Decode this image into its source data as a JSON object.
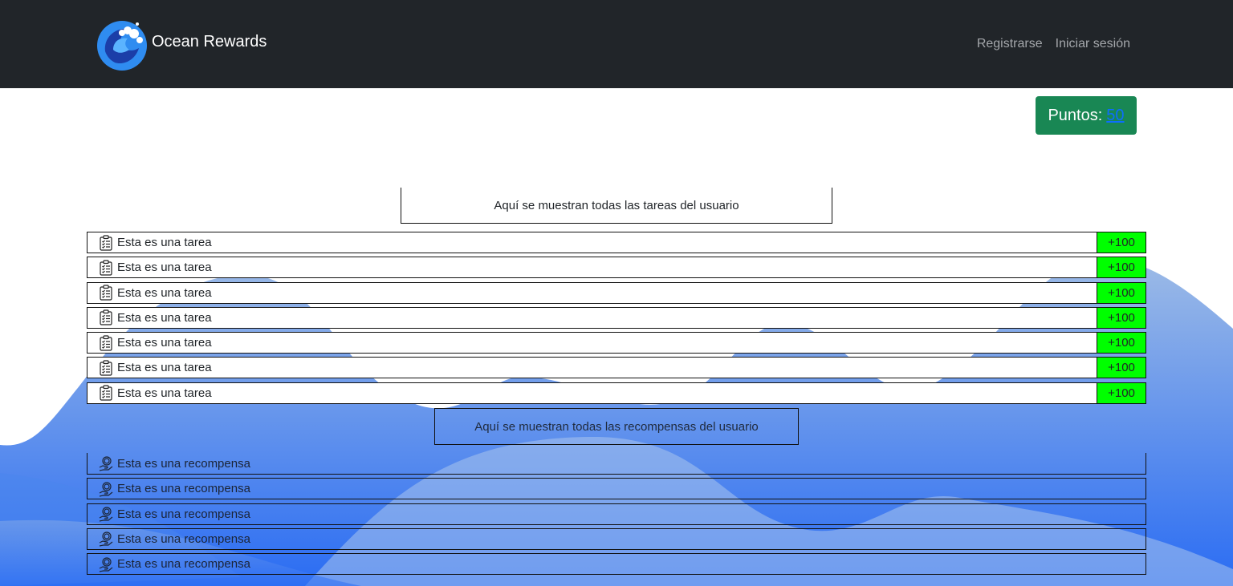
{
  "app": {
    "brand": "Ocean Rewards"
  },
  "nav": {
    "register": "Registrarse",
    "login": "Iniciar sesión"
  },
  "points": {
    "label": "Puntos:",
    "value": "50"
  },
  "tasks": {
    "title": "Aquí se muestran todas las tareas del usuario",
    "items": [
      {
        "label": "Esta es una tarea",
        "reward": "+100"
      },
      {
        "label": "Esta es una tarea",
        "reward": "+100"
      },
      {
        "label": "Esta es una tarea",
        "reward": "+100"
      },
      {
        "label": "Esta es una tarea",
        "reward": "+100"
      },
      {
        "label": "Esta es una tarea",
        "reward": "+100"
      },
      {
        "label": "Esta es una tarea",
        "reward": "+100"
      },
      {
        "label": "Esta es una tarea",
        "reward": "+100"
      }
    ]
  },
  "rewards": {
    "title": "Aquí se muestran todas las recompensas del usuario",
    "items": [
      {
        "label": "Esta es una recompensa"
      },
      {
        "label": "Esta es una recompensa"
      },
      {
        "label": "Esta es una recompensa"
      },
      {
        "label": "Esta es una recompensa"
      },
      {
        "label": "Esta es una recompensa"
      }
    ]
  },
  "icons": {
    "logo": "ocean-wave-logo",
    "task": "clipboard-checklist-icon",
    "reward": "hand-coin-icon"
  },
  "colors": {
    "navbar": "#212529",
    "points_button": "#198754",
    "points_link": "#0d6efd",
    "task_badge": "#00ff00",
    "wave_light": "#8fb4e6",
    "wave_deep": "#2d6ff2"
  }
}
